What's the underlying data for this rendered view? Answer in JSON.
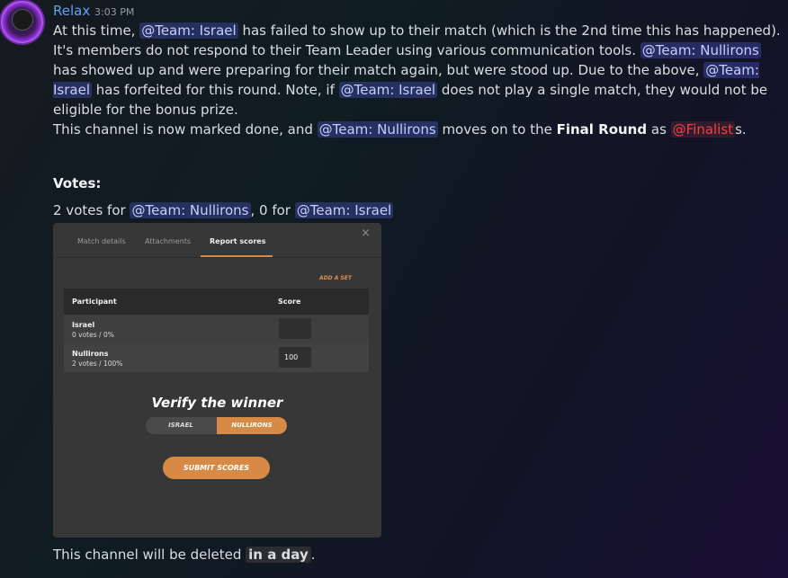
{
  "message": {
    "author": "Relax",
    "timestamp": "3:03 PM",
    "line1_pre": "At this time, ",
    "mention_israel": "@Team: Israel",
    "mention_nullirons": "@Team: Nullirons",
    "mention_finalist": "@Finalist",
    "line1_post": " has failed to show up to their match (which is the 2nd time this has happened). It's members do not respond to their Team Leader using various communication tools. ",
    "line1_mid": " has showed up and were preparing for their match again, but were stood up. Due to the above, ",
    "line1_mid2": " has forfeited for this round. Note, if ",
    "line1_end": " does not play a single match, they would not be eligible for the bonus prize.",
    "p2_pre": "This channel is now marked done, and ",
    "p2_mid": " moves on to the ",
    "p2_bold": "Final Round",
    "p2_as": " as ",
    "p2_end": "s.",
    "votes_heading": "Votes:",
    "votes_pre": "2 votes for ",
    "votes_mid": ", 0 for ",
    "footer_pre": "This channel will be deleted ",
    "footer_code": "in a day",
    "footer_end": "."
  },
  "embed": {
    "tabs": [
      "Match details",
      "Attachments",
      "Report scores"
    ],
    "close": "×",
    "add_set": "ADD A SET",
    "col_participant": "Participant",
    "col_score": "Score",
    "rows": [
      {
        "name": "Israel",
        "votes": "0 votes / 0%",
        "score": ""
      },
      {
        "name": "Nullirons",
        "votes": "2 votes / 100%",
        "score": "100"
      }
    ],
    "verify_title": "Verify the winner",
    "toggle": [
      "ISRAEL",
      "NULLIRONS"
    ],
    "toggle_selected": "NULLIRONS",
    "submit": "SUBMIT SCORES"
  },
  "colors": {
    "accent": "#d68a45",
    "mention_bg": "#3a3f8a",
    "username": "#5ea3f2"
  }
}
